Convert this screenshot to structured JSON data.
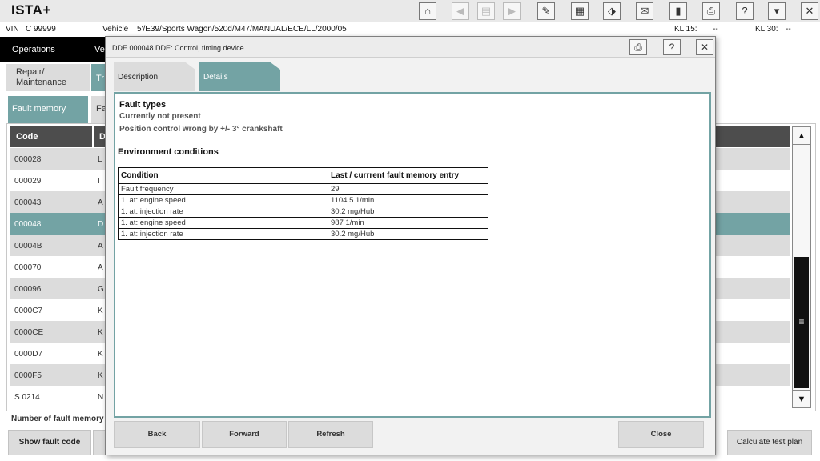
{
  "app": {
    "title": "ISTA+"
  },
  "toolbar": {
    "icons": [
      "home-icon",
      "back-icon",
      "clipboard-icon",
      "forward-icon",
      "wrench-icon",
      "documents-icon",
      "connection-icon",
      "mail-icon",
      "battery-icon",
      "print-icon",
      "help-icon",
      "minimize-icon",
      "close-icon"
    ],
    "glyphs": [
      "⌂",
      "◀",
      "▤",
      "▶",
      "✎",
      "▦",
      "⬗",
      "✉",
      "▮",
      "⎙",
      "?",
      "▾",
      "✕"
    ]
  },
  "vehicle_bar": {
    "vin_label": "VIN",
    "vin_value": "C 99999",
    "vehicle_label": "Vehicle",
    "vehicle_value": "5'/E39/Sports Wagon/520d/M47/MANUAL/ECE/LL/2000/05",
    "kl15_label": "KL 15:",
    "kl15_value": "--",
    "kl30_label": "KL 30:",
    "kl30_value": "--"
  },
  "nav": {
    "operations": "Operations",
    "vehicle_partial": "Ve",
    "repair": "Repair/ Maintenance",
    "tr_partial": "Tr",
    "fault_memory": "Fault memory",
    "fa_partial": "Fa"
  },
  "fault_list": {
    "header_code": "Code",
    "header_d": "D",
    "rows": [
      {
        "code": "000028",
        "d": "L"
      },
      {
        "code": "000029",
        "d": "I"
      },
      {
        "code": "000043",
        "d": "A"
      },
      {
        "code": "000048",
        "d": "D"
      },
      {
        "code": "00004B",
        "d": "A"
      },
      {
        "code": "000070",
        "d": "A"
      },
      {
        "code": "000096",
        "d": "G"
      },
      {
        "code": "0000C7",
        "d": "K"
      },
      {
        "code": "0000CE",
        "d": "K"
      },
      {
        "code": "0000D7",
        "d": "K"
      },
      {
        "code": "0000F5",
        "d": "K"
      },
      {
        "code": "S 0214",
        "d": "N"
      }
    ],
    "selected_index": 3,
    "count_label": "Number of fault memory",
    "show_fault_code": "Show fault code",
    "calculate_test_plan": "Calculate test plan"
  },
  "dialog": {
    "title": "DDE 000048 DDE: Control, timing device",
    "tab_description": "Description",
    "tab_details": "Details",
    "fault_types_title": "Fault types",
    "fault_status": "Currently not present",
    "fault_detail": "Position control wrong by +/- 3° crankshaft",
    "environment_title": "Environment conditions",
    "table_headers": [
      "Condition",
      "Last / currrent fault memory entry"
    ],
    "table_rows": [
      [
        "Fault frequency",
        "29"
      ],
      [
        "1. at: engine speed",
        "1104.5 1/min"
      ],
      [
        "1. at: injection rate",
        "30.2 mg/Hub"
      ],
      [
        "1. at: engine speed",
        "987 1/min"
      ],
      [
        "1. at: injection rate",
        "30.2 mg/Hub"
      ]
    ],
    "back": "Back",
    "forward": "Forward",
    "refresh": "Refresh",
    "close": "Close"
  }
}
